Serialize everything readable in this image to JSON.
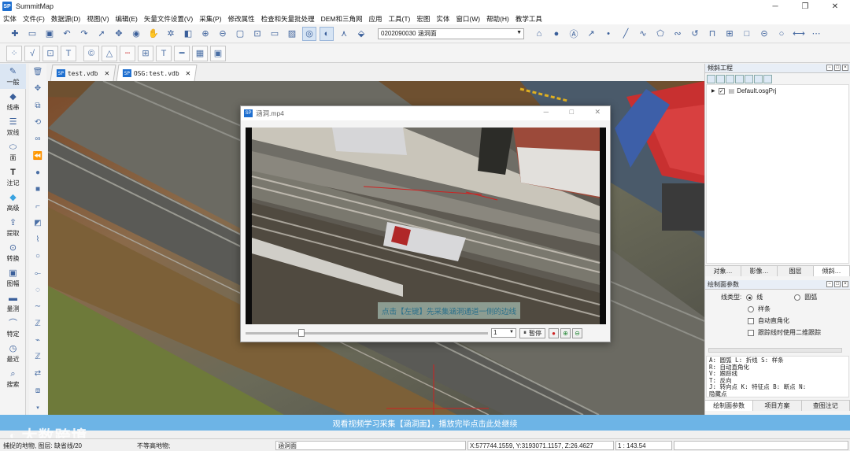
{
  "app": {
    "title": "SummitMap",
    "logo_text": "SP"
  },
  "window_controls": {
    "minimize": "─",
    "maximize": "❐",
    "close": "✕"
  },
  "menu": [
    "实体",
    "文件(F)",
    "数据源(D)",
    "视图(V)",
    "编辑(E)",
    "矢量文件设置(V)",
    "采集(P)",
    "修改属性",
    "检查和矢量批处理",
    "DEM和三角网",
    "应用",
    "工具(T)",
    "宏图",
    "实体",
    "窗口(W)",
    "帮助(H)",
    "教学工具"
  ],
  "layer_combo": {
    "value": "0202090030  涵洞面"
  },
  "left_tools": [
    {
      "label": "一般",
      "icon": "pen-icon"
    },
    {
      "label": "线串",
      "icon": "line-icon"
    },
    {
      "label": "双线",
      "icon": "double-line-icon"
    },
    {
      "label": "面",
      "icon": "polygon-icon"
    },
    {
      "label": "注记",
      "icon": "text-icon"
    },
    {
      "label": "高级",
      "icon": "diamond-icon"
    },
    {
      "label": "提取",
      "icon": "extract-icon"
    },
    {
      "label": "转换",
      "icon": "convert-icon"
    },
    {
      "label": "图幅",
      "icon": "map-sheet-icon"
    },
    {
      "label": "量测",
      "icon": "measure-icon"
    },
    {
      "label": "特定",
      "icon": "arc-icon"
    },
    {
      "label": "最近",
      "icon": "clock-icon"
    },
    {
      "label": "搜索",
      "icon": "search-icon"
    }
  ],
  "tabs": [
    {
      "name": "test.vdb",
      "close": "✕"
    },
    {
      "name": "OSG:test.vdb",
      "close": "✕"
    }
  ],
  "right_panel": {
    "project": {
      "title": "倾斜工程",
      "tree_item": "Default.osgPrj"
    },
    "tabs": [
      "对象…",
      "影像…",
      "图层",
      "倾斜…"
    ],
    "params": {
      "title": "绘制面参数",
      "line_type_label": "线类型:",
      "line": "线",
      "arc": "圆弧",
      "spline": "样条",
      "auto_right_angle": "自动直角化",
      "track_2d": "跟踪线时使用二维跟踪"
    },
    "shortcuts": [
      "A: 圆弧   L: 折线   S: 样条",
      "R: 自动直角化",
      "V: 跟踪线",
      "T: 反向",
      "J: 转向点   K: 特征点   B: 断点   N:",
      "隐藏点"
    ],
    "bottom_tabs": [
      "绘制面参数",
      "项目方案",
      "查图注记"
    ]
  },
  "video": {
    "title": "涵洞.mp4",
    "subtitle": "点击【左键】先采集涵洞通道一侧的边线",
    "speed": "1",
    "pause_label": "暂停",
    "progress": 0.23
  },
  "notice": "观看视频学习采集【涵洞面】，播放完毕点击此处继续",
  "watermark": "大数跨境",
  "status": {
    "capture": "捕捉的地物, 图层: 缺省线/20",
    "no_height": "不等高地物;",
    "layer": "涵洞面",
    "coords": "X:577744.1559, Y:3193071.1157, Z:26.4627",
    "scale": "1 : 143.54"
  }
}
